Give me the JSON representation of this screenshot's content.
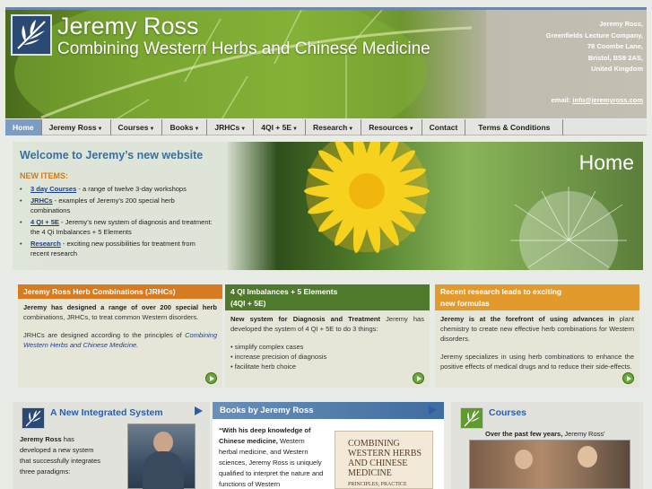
{
  "header": {
    "title": "Jeremy Ross",
    "tagline": "Combining Western Herbs and Chinese Medicine",
    "address": [
      "Jeremy Ross,",
      "Greenfields Lecture Company,",
      "78 Coombe Lane,",
      "Bristol, BS9 2AS,",
      "United Kingdom"
    ],
    "email_label": "email:",
    "email": "info@jeremyross.com",
    "logo_icon": "bamboo-leaf-logo-icon"
  },
  "nav": [
    {
      "label": "Home",
      "dropdown": false,
      "active": true
    },
    {
      "label": "Jeremy Ross",
      "dropdown": true
    },
    {
      "label": "Courses",
      "dropdown": true
    },
    {
      "label": "Books",
      "dropdown": true
    },
    {
      "label": "JRHCs",
      "dropdown": true
    },
    {
      "label": "4QI + 5E",
      "dropdown": true
    },
    {
      "label": "Research",
      "dropdown": true
    },
    {
      "label": "Resources",
      "dropdown": true
    },
    {
      "label": "Contact",
      "dropdown": false
    },
    {
      "label": "Terms & Conditions",
      "dropdown": false
    }
  ],
  "hero": {
    "title": "Welcome to Jeremy’s new website",
    "new_items": "NEW ITEMS:",
    "items": [
      {
        "link": "3 day Courses",
        "text": " - a range of twelve 3-day workshops"
      },
      {
        "link": "JRHCs",
        "text": " - examples of Jeremy’s 200 special herb combinations"
      },
      {
        "link": "4 QI + 5E",
        "text": " - Jeremy’s new system of diagnosis and treatment: the 4 Qi Imbalances + 5 Elements"
      },
      {
        "link": "Research",
        "text": " - exciting new possibilities for treatment from recent research"
      }
    ],
    "home_word": "Home"
  },
  "bands": [
    {
      "head": "Jeremy Ross Herb Combinations (JRHCs)",
      "head_color": "#d77a20",
      "p1_bold": "Jeremy has designed a range of over 200 special herb",
      "p1_rest": " combinations, JRHCs, to treat common Western disorders.",
      "p2_text": "JRHCs are designed according to the principles of ",
      "p2_em": "Combining Western Herbs and Chinese Medicine."
    },
    {
      "head_line1": "4 QI Imbalances + 5 Elements",
      "head_line2": "(4QI + 5E)",
      "head_color": "#4f7a2c",
      "p1_bold": "New system for Diagnosis and Treatment",
      "p1_rest": " Jeremy has developed the system of 4 QI + 5E to do 3 things:",
      "bullets": [
        "• simplify complex cases",
        "• increase precision of diagnosis",
        "• facilitate herb choice"
      ]
    },
    {
      "head_line1": "Recent research leads to exciting",
      "head_line2": "new formulas",
      "head_color": "#e39a2c",
      "p1_bold": "Jeremy is at the forefront of using advances in",
      "p1_rest": " plant chemistry to create new effective herb combinations for Western disorders.",
      "p2_text": "Jeremy specializes in using herb combinations to enhance the positive effects of medical drugs and to reduce their side-effects."
    }
  ],
  "panels": {
    "integrated": {
      "title": "A New Integrated System",
      "bold": "Jeremy Ross",
      "text": " has developed a new system that successfully integrates three paradigms:"
    },
    "books": {
      "title": "Books by Jeremy Ross",
      "quote_bold": "“With his deep knowledge of Chinese medicine,",
      "quote_rest": " Western herbal medicine, and Western sciences, Jeremy Ross is uniquely qualified to interpret the nature and functions of Western",
      "book_cover": [
        "COMBINING",
        "WESTERN HERBS",
        "AND CHINESE",
        "MEDICINE"
      ],
      "book_sub": "PRINCIPLES, PRACTICE"
    },
    "courses": {
      "title": "Courses",
      "text_bold": "Over the past few years,",
      "text_rest": " Jeremy Ross'"
    }
  }
}
